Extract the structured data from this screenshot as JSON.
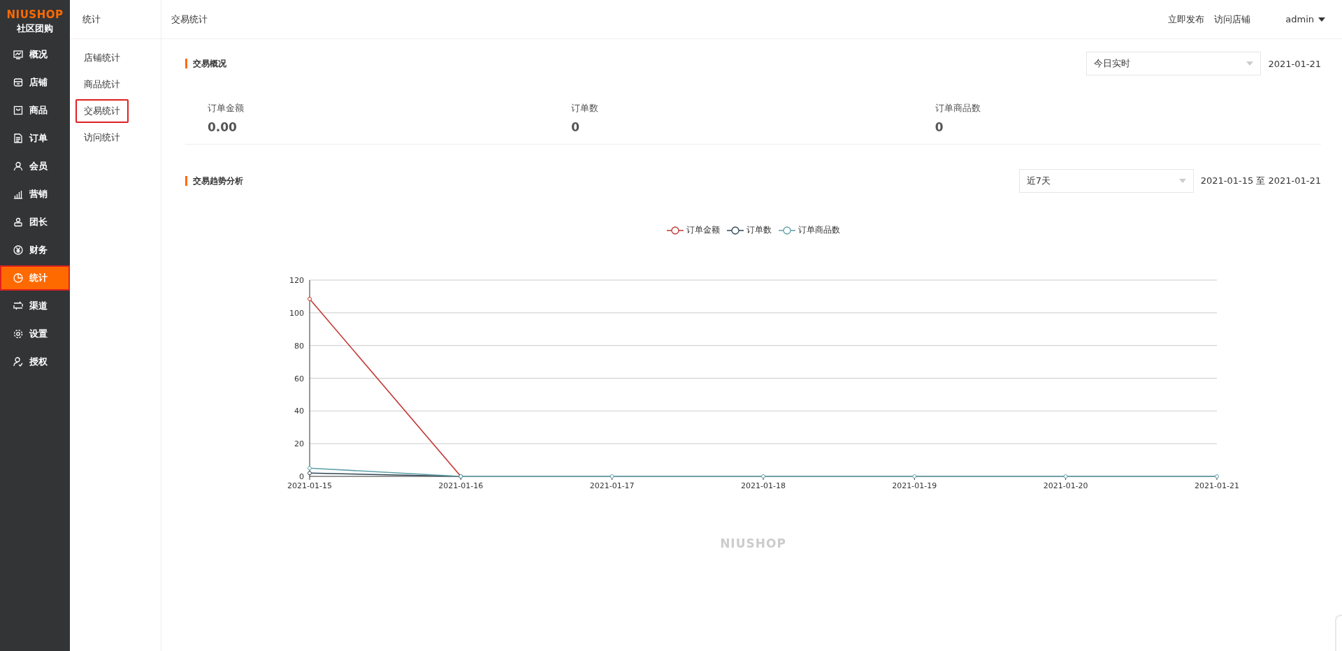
{
  "brand": {
    "logo": "NIUSHOP",
    "subtitle": "社区团购"
  },
  "nav": [
    {
      "label": "概况",
      "selected": false
    },
    {
      "label": "店铺",
      "selected": false
    },
    {
      "label": "商品",
      "selected": false
    },
    {
      "label": "订单",
      "selected": false
    },
    {
      "label": "会员",
      "selected": false
    },
    {
      "label": "营销",
      "selected": false
    },
    {
      "label": "团长",
      "selected": false
    },
    {
      "label": "财务",
      "selected": false
    },
    {
      "label": "统计",
      "selected": true
    },
    {
      "label": "渠道",
      "selected": false
    },
    {
      "label": "设置",
      "selected": false
    },
    {
      "label": "授权",
      "selected": false
    }
  ],
  "subnav": {
    "title": "统计",
    "items": [
      {
        "label": "店铺统计",
        "selected": false
      },
      {
        "label": "商品统计",
        "selected": false
      },
      {
        "label": "交易统计",
        "selected": true
      },
      {
        "label": "访问统计",
        "selected": false
      }
    ]
  },
  "header": {
    "breadcrumb": "交易统计",
    "links": [
      "立即发布",
      "访问店铺"
    ],
    "user": "admin"
  },
  "overview": {
    "title": "交易概况",
    "select": "今日实时",
    "date": "2021-01-21",
    "stats": [
      {
        "label": "订单金额",
        "value": "0.00"
      },
      {
        "label": "订单数",
        "value": "0"
      },
      {
        "label": "订单商品数",
        "value": "0"
      }
    ]
  },
  "trend": {
    "title": "交易趋势分析",
    "select": "近7天",
    "date_range": "2021-01-15 至 2021-01-21",
    "chart_data": {
      "type": "line",
      "categories": [
        "2021-01-15",
        "2021-01-16",
        "2021-01-17",
        "2021-01-18",
        "2021-01-19",
        "2021-01-20",
        "2021-01-21"
      ],
      "series": [
        {
          "name": "订单金额",
          "color": "#c23531",
          "marker": true,
          "values": [
            108.5,
            0,
            null,
            null,
            null,
            null,
            null
          ]
        },
        {
          "name": "订单数",
          "color": "#2f4554",
          "marker": true,
          "values": [
            2,
            0,
            null,
            null,
            null,
            null,
            null
          ]
        },
        {
          "name": "订单商品数",
          "color": "#61a0a8",
          "marker": true,
          "values": [
            5,
            0,
            0,
            0,
            0,
            0,
            0
          ]
        }
      ],
      "ylim": [
        0,
        120
      ],
      "yticks": [
        0,
        20,
        40,
        60,
        80,
        100,
        120
      ],
      "grid": true
    }
  },
  "footer": {
    "logo": "NIUSHOP"
  }
}
